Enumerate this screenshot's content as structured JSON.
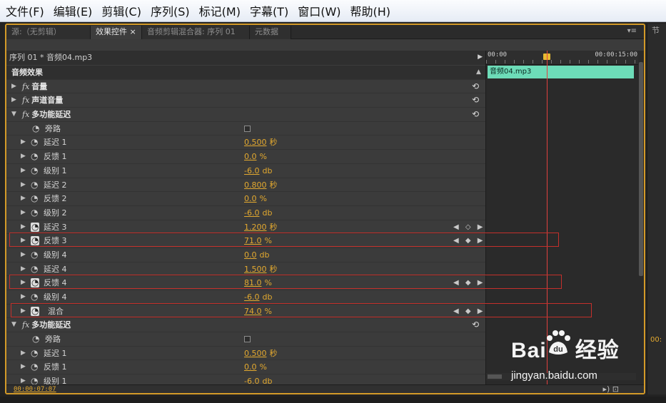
{
  "menu": [
    "文件(F)",
    "编辑(E)",
    "剪辑(C)",
    "序列(S)",
    "标记(M)",
    "字幕(T)",
    "窗口(W)",
    "帮助(H)"
  ],
  "tabs": [
    {
      "label": "源:（无剪辑）",
      "active": false
    },
    {
      "label": "效果控件 ×",
      "active": true
    },
    {
      "label": "音频剪辑混合器: 序列 01",
      "active": false
    },
    {
      "label": "元数据",
      "active": false
    }
  ],
  "tab_menu_icon": "panel-menu-icon",
  "sequence_label": "序列 01 * 音频04.mp3",
  "timeline": {
    "start": "00:00",
    "end": "00:00:15:00",
    "clip": "音频04.mp3"
  },
  "rows": [
    {
      "type": "header",
      "label": "音频效果"
    },
    {
      "type": "effect",
      "label": "音量",
      "fx": "fx",
      "expanded": false,
      "reset": true
    },
    {
      "type": "effect",
      "label": "声道音量",
      "fx": "fx",
      "expanded": false,
      "reset": true
    },
    {
      "type": "effect",
      "label": "多功能延迟",
      "fx": "fx",
      "expanded": true,
      "reset": true
    },
    {
      "type": "bypass",
      "label": "旁路"
    },
    {
      "type": "param",
      "label": "延迟 1",
      "num": "0.500",
      "unit": "秒",
      "animated": false
    },
    {
      "type": "param",
      "label": "反馈 1",
      "num": "0.0",
      "unit": "%",
      "animated": false
    },
    {
      "type": "param",
      "label": "级别 1",
      "num": "-6.0",
      "unit": "db",
      "animated": false
    },
    {
      "type": "param",
      "label": "延迟 2",
      "num": "0.800",
      "unit": "秒",
      "animated": false
    },
    {
      "type": "param",
      "label": "反馈 2",
      "num": "0.0",
      "unit": "%",
      "animated": false
    },
    {
      "type": "param",
      "label": "级别 2",
      "num": "-6.0",
      "unit": "db",
      "animated": false
    },
    {
      "type": "param",
      "label": "延迟 3",
      "num": "1.200",
      "unit": "秒",
      "animated": true,
      "kf_nav": "◀ ◇ ▶",
      "tl_kf": "▷",
      "diamond": ""
    },
    {
      "type": "param",
      "label": "反馈 3",
      "num": "71.0",
      "unit": "%",
      "animated": true,
      "kf_nav": "◀ ◆ ▶",
      "tl_kf": "▸",
      "diamond": "◆"
    },
    {
      "type": "param",
      "label": "级别 4",
      "num": "0.0",
      "unit": "db",
      "animated": false
    },
    {
      "type": "param",
      "label": "延迟 4",
      "num": "1.500",
      "unit": "秒",
      "animated": false
    },
    {
      "type": "param",
      "label": "反馈 4",
      "num": "81.0",
      "unit": "%",
      "animated": true,
      "kf_nav": "◀ ◆ ▶",
      "tl_kf": "▸",
      "diamond": "◆"
    },
    {
      "type": "param",
      "label": "级别 4",
      "num": "-6.0",
      "unit": "db",
      "animated": false
    },
    {
      "type": "param",
      "label": "混合",
      "num": "74.0",
      "unit": "%",
      "animated": true,
      "kf_nav": "◀ ◆ ▶",
      "tl_kf": "▸",
      "diamond": "◆"
    },
    {
      "type": "effect",
      "label": "多功能延迟",
      "fx": "fx",
      "expanded": true,
      "reset": true
    },
    {
      "type": "bypass",
      "label": "旁路"
    },
    {
      "type": "param",
      "label": "延迟 1",
      "num": "0.500",
      "unit": "秒",
      "animated": false
    },
    {
      "type": "param",
      "label": "反馈 1",
      "num": "0.0",
      "unit": "%",
      "animated": false
    },
    {
      "type": "param",
      "label": "级别 1",
      "num": "-6.0",
      "unit": "db",
      "animated": false
    }
  ],
  "status_timecode": "00:00:07:07",
  "right_panel_timecode": "00:",
  "right_panel_tab": "节",
  "watermark": {
    "logo_left": "Bai",
    "logo_right": "经验",
    "url": "jingyan.baidu.com"
  },
  "colors": {
    "panel_border": "#d39a28",
    "value": "#e3a92f",
    "clip": "#6ddcb8",
    "playhead": "#e0413f",
    "highlight": "#c4302b"
  }
}
